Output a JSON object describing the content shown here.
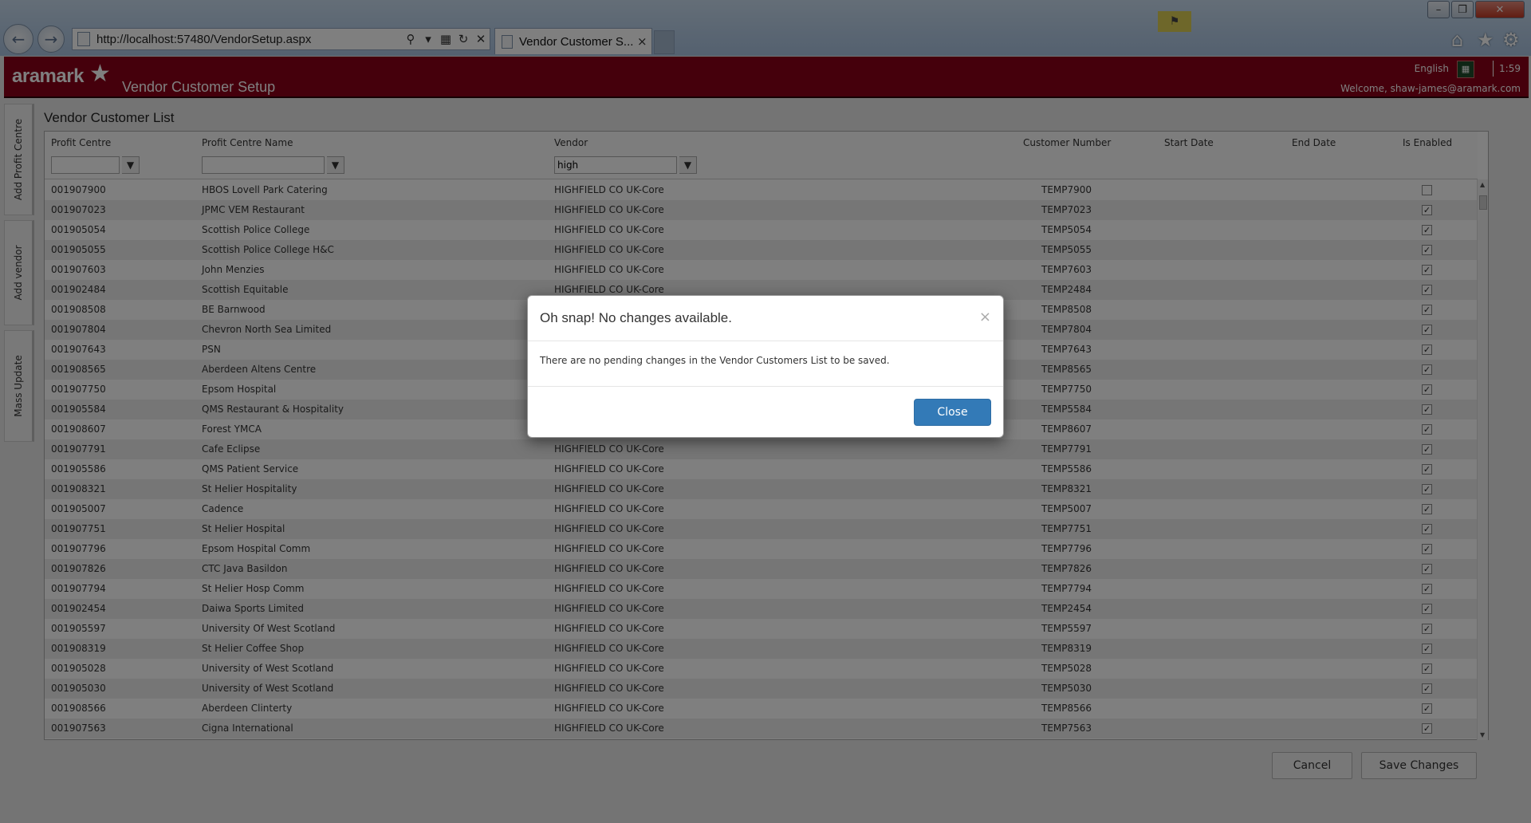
{
  "browser": {
    "url": "http://localhost:57480/VendorSetup.aspx",
    "tab_title": "Vendor Customer S...",
    "back_icon": "back-arrow-icon",
    "forward_icon": "forward-arrow-icon",
    "search_icon": "search-icon",
    "refresh_icon": "refresh-icon",
    "stop_icon": "close-icon",
    "tab_close": "×",
    "home_icon": "⌂",
    "favorites_icon": "★",
    "tools_icon": "⚙"
  },
  "header": {
    "brand": "aramark",
    "app_title": "Vendor Customer Setup",
    "language": "English",
    "time": "1:59",
    "welcome": "Welcome, shaw-james@aramark.com",
    "accent_color": "#8b0019"
  },
  "side_tabs": [
    "Add Profit Centre",
    "Add vendor",
    "Mass Update"
  ],
  "list": {
    "title": "Vendor Customer List",
    "columns": [
      "Profit Centre",
      "Profit Centre Name",
      "Vendor",
      "Customer Number",
      "Start Date",
      "End Date",
      "Is Enabled"
    ],
    "filters": {
      "profit_centre": "",
      "profit_centre_name": "",
      "vendor": "high"
    },
    "rows": [
      {
        "pc": "001907900",
        "name": "HBOS Lovell Park Catering",
        "vendor": "HIGHFIELD CO UK-Core",
        "cust": "TEMP7900",
        "enabled": false
      },
      {
        "pc": "001907023",
        "name": "JPMC VEM Restaurant",
        "vendor": "HIGHFIELD CO UK-Core",
        "cust": "TEMP7023",
        "enabled": true
      },
      {
        "pc": "001905054",
        "name": "Scottish Police College",
        "vendor": "HIGHFIELD CO UK-Core",
        "cust": "TEMP5054",
        "enabled": true
      },
      {
        "pc": "001905055",
        "name": "Scottish Police College H&C",
        "vendor": "HIGHFIELD CO UK-Core",
        "cust": "TEMP5055",
        "enabled": true
      },
      {
        "pc": "001907603",
        "name": "John Menzies",
        "vendor": "HIGHFIELD CO UK-Core",
        "cust": "TEMP7603",
        "enabled": true
      },
      {
        "pc": "001902484",
        "name": "Scottish Equitable",
        "vendor": "HIGHFIELD CO UK-Core",
        "cust": "TEMP2484",
        "enabled": true
      },
      {
        "pc": "001908508",
        "name": "BE Barnwood",
        "vendor": "",
        "cust": "TEMP8508",
        "enabled": true
      },
      {
        "pc": "001907804",
        "name": "Chevron North Sea Limited",
        "vendor": "",
        "cust": "TEMP7804",
        "enabled": true
      },
      {
        "pc": "001907643",
        "name": "PSN",
        "vendor": "",
        "cust": "TEMP7643",
        "enabled": true
      },
      {
        "pc": "001908565",
        "name": "Aberdeen Altens Centre",
        "vendor": "",
        "cust": "TEMP8565",
        "enabled": true
      },
      {
        "pc": "001907750",
        "name": "Epsom Hospital",
        "vendor": "",
        "cust": "TEMP7750",
        "enabled": true
      },
      {
        "pc": "001905584",
        "name": "QMS Restaurant & Hospitality",
        "vendor": "",
        "cust": "TEMP5584",
        "enabled": true
      },
      {
        "pc": "001908607",
        "name": "Forest YMCA",
        "vendor": "",
        "cust": "TEMP8607",
        "enabled": true
      },
      {
        "pc": "001907791",
        "name": "Cafe Eclipse",
        "vendor": "HIGHFIELD CO UK-Core",
        "cust": "TEMP7791",
        "enabled": true
      },
      {
        "pc": "001905586",
        "name": "QMS Patient Service",
        "vendor": "HIGHFIELD CO UK-Core",
        "cust": "TEMP5586",
        "enabled": true
      },
      {
        "pc": "001908321",
        "name": "St Helier Hospitality",
        "vendor": "HIGHFIELD CO UK-Core",
        "cust": "TEMP8321",
        "enabled": true
      },
      {
        "pc": "001905007",
        "name": "Cadence",
        "vendor": "HIGHFIELD CO UK-Core",
        "cust": "TEMP5007",
        "enabled": true
      },
      {
        "pc": "001907751",
        "name": "St Helier Hospital",
        "vendor": "HIGHFIELD CO UK-Core",
        "cust": "TEMP7751",
        "enabled": true
      },
      {
        "pc": "001907796",
        "name": "Epsom Hospital Comm",
        "vendor": "HIGHFIELD CO UK-Core",
        "cust": "TEMP7796",
        "enabled": true
      },
      {
        "pc": "001907826",
        "name": "CTC Java Basildon",
        "vendor": "HIGHFIELD CO UK-Core",
        "cust": "TEMP7826",
        "enabled": true
      },
      {
        "pc": "001907794",
        "name": "St Helier Hosp Comm",
        "vendor": "HIGHFIELD CO UK-Core",
        "cust": "TEMP7794",
        "enabled": true
      },
      {
        "pc": "001902454",
        "name": "Daiwa Sports Limited",
        "vendor": "HIGHFIELD CO UK-Core",
        "cust": "TEMP2454",
        "enabled": true
      },
      {
        "pc": "001905597",
        "name": "University Of West Scotland",
        "vendor": "HIGHFIELD CO UK-Core",
        "cust": "TEMP5597",
        "enabled": true
      },
      {
        "pc": "001908319",
        "name": "St Helier Coffee Shop",
        "vendor": "HIGHFIELD CO UK-Core",
        "cust": "TEMP8319",
        "enabled": true
      },
      {
        "pc": "001905028",
        "name": "University of West Scotland",
        "vendor": "HIGHFIELD CO UK-Core",
        "cust": "TEMP5028",
        "enabled": true
      },
      {
        "pc": "001905030",
        "name": "University of West Scotland",
        "vendor": "HIGHFIELD CO UK-Core",
        "cust": "TEMP5030",
        "enabled": true
      },
      {
        "pc": "001908566",
        "name": "Aberdeen Clinterty",
        "vendor": "HIGHFIELD CO UK-Core",
        "cust": "TEMP8566",
        "enabled": true
      },
      {
        "pc": "001907563",
        "name": "Cigna International",
        "vendor": "HIGHFIELD CO UK-Core",
        "cust": "TEMP7563",
        "enabled": true
      }
    ]
  },
  "actions": {
    "cancel": "Cancel",
    "save": "Save Changes"
  },
  "modal": {
    "title": "Oh snap! No changes available.",
    "close_x": "×",
    "body": "There are no pending changes in the Vendor Customers List to be saved.",
    "close_button": "Close",
    "button_color": "#337ab7"
  }
}
